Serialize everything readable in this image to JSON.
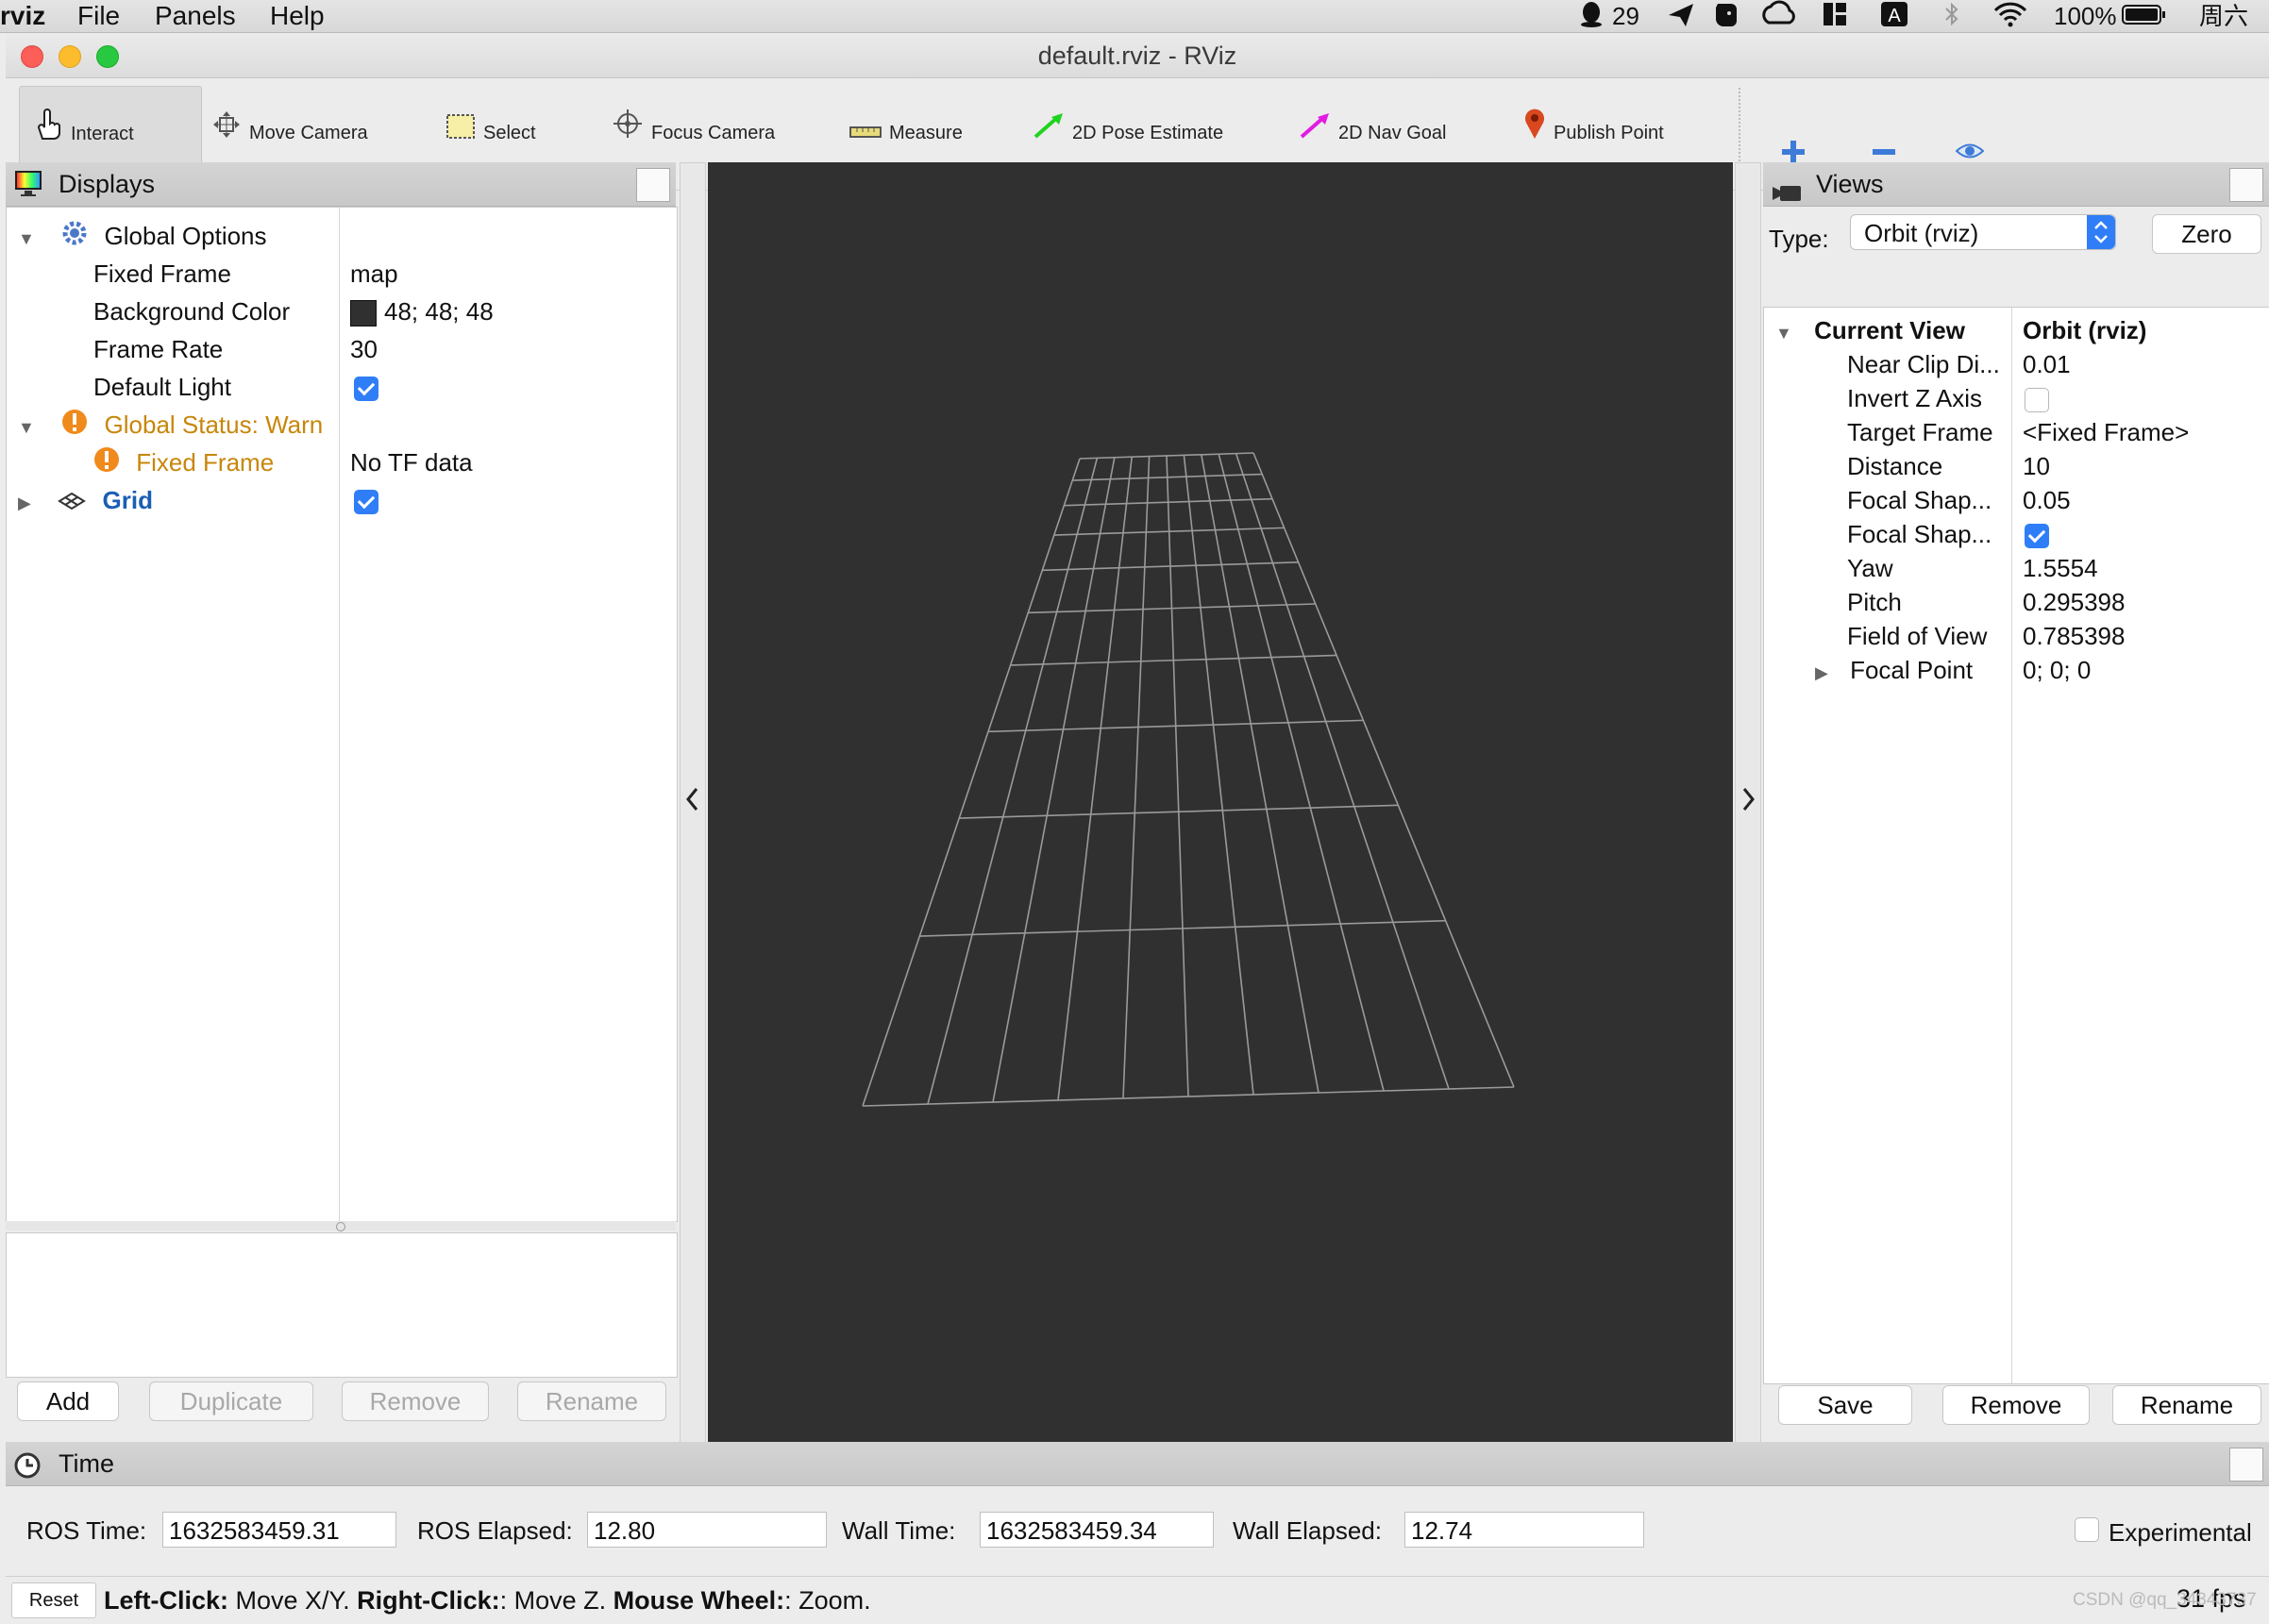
{
  "menubar": {
    "app_name": "rviz",
    "items": [
      "File",
      "Panels",
      "Help"
    ],
    "status": {
      "notification_count": "29",
      "battery": "100%",
      "day": "周六"
    }
  },
  "window": {
    "title": "default.rviz - RViz"
  },
  "toolbar": {
    "tools": [
      {
        "label": "Interact",
        "icon": "hand-pointer-icon",
        "active": true
      },
      {
        "label": "Move Camera",
        "icon": "move-arrows-icon"
      },
      {
        "label": "Select",
        "icon": "select-rect-icon"
      },
      {
        "label": "Focus Camera",
        "icon": "crosshair-icon"
      },
      {
        "label": "Measure",
        "icon": "ruler-icon"
      },
      {
        "label": "2D Pose Estimate",
        "icon": "green-arrow-icon"
      },
      {
        "label": "2D Nav Goal",
        "icon": "magenta-arrow-icon"
      },
      {
        "label": "Publish Point",
        "icon": "map-pin-icon"
      }
    ]
  },
  "displays": {
    "header": "Displays",
    "global_options": "Global Options",
    "rows": [
      {
        "name": "Fixed Frame",
        "value": "map"
      },
      {
        "name": "Background Color",
        "value": "48; 48; 48",
        "swatch": "#303030"
      },
      {
        "name": "Frame Rate",
        "value": "30"
      },
      {
        "name": "Default Light",
        "checked": true
      }
    ],
    "global_status": "Global Status: Warn",
    "status_child": {
      "name": "Fixed Frame",
      "value": "No TF data"
    },
    "grid": {
      "name": "Grid",
      "checked": true
    },
    "buttons": {
      "add": "Add",
      "duplicate": "Duplicate",
      "remove": "Remove",
      "rename": "Rename"
    }
  },
  "views": {
    "header": "Views",
    "type_label": "Type:",
    "type_value": "Orbit (rviz)",
    "zero_button": "Zero",
    "current_view": "Current View",
    "current_view_value": "Orbit (rviz)",
    "rows": [
      {
        "name": "Near Clip Di...",
        "value": "0.01"
      },
      {
        "name": "Invert Z Axis",
        "checked": false
      },
      {
        "name": "Target Frame",
        "value": "<Fixed Frame>"
      },
      {
        "name": "Distance",
        "value": "10"
      },
      {
        "name": "Focal Shap...",
        "value": "0.05"
      },
      {
        "name": "Focal Shap...",
        "checked": true
      },
      {
        "name": "Yaw",
        "value": "1.5554"
      },
      {
        "name": "Pitch",
        "value": "0.295398"
      },
      {
        "name": "Field of View",
        "value": "0.785398"
      },
      {
        "name": "Focal Point",
        "value": "0; 0; 0"
      }
    ],
    "buttons": {
      "save": "Save",
      "remove": "Remove",
      "rename": "Rename"
    }
  },
  "time": {
    "header": "Time",
    "ros_time_label": "ROS Time:",
    "ros_time": "1632583459.31",
    "ros_elapsed_label": "ROS Elapsed:",
    "ros_elapsed": "12.80",
    "wall_time_label": "Wall Time:",
    "wall_time": "1632583459.34",
    "wall_elapsed_label": "Wall Elapsed:",
    "wall_elapsed": "12.74",
    "experimental_label": "Experimental"
  },
  "status": {
    "reset_button": "Reset",
    "hint_left_click": "Left-Click:",
    "hint_left_text": " Move X/Y. ",
    "hint_right_click": "Right-Click:",
    "hint_right_text": ": Move Z. ",
    "hint_wheel": "Mouse Wheel:",
    "hint_wheel_text": ": Zoom.",
    "fps": "31 fps",
    "watermark": "CSDN @qq_34343737"
  },
  "colors": {
    "viewport_bg": "#303030",
    "grid_line": "#a0a0a0",
    "warn": "#c8860a",
    "grid_label": "#1a5fb4",
    "checkbox": "#2f7ef7"
  }
}
